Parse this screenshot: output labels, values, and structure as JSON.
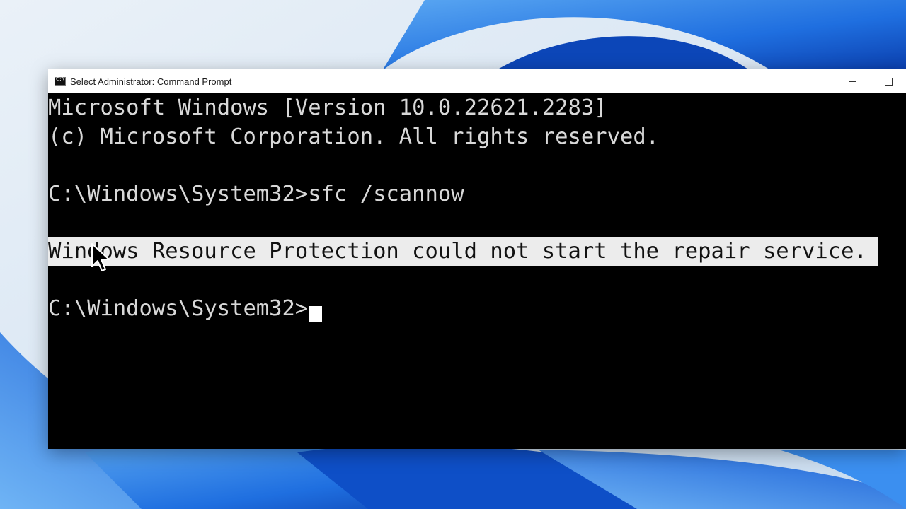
{
  "window": {
    "title": "Select Administrator: Command Prompt",
    "controls": {
      "minimize_icon": "minimize-icon",
      "maximize_icon": "maximize-icon"
    }
  },
  "console": {
    "lines": [
      "Microsoft Windows [Version 10.0.22621.2283]",
      "(c) Microsoft Corporation. All rights reserved.",
      "C:\\Windows\\System32>sfc /scannow",
      "Windows Resource Protection could not start the repair service.",
      "C:\\Windows\\System32>"
    ],
    "selected_line_index": 3
  },
  "colors": {
    "console_bg": "#000000",
    "console_fg": "#d8d8d8",
    "selection_bg": "#ececec",
    "wallpaper_blue": "#1a73e8"
  }
}
